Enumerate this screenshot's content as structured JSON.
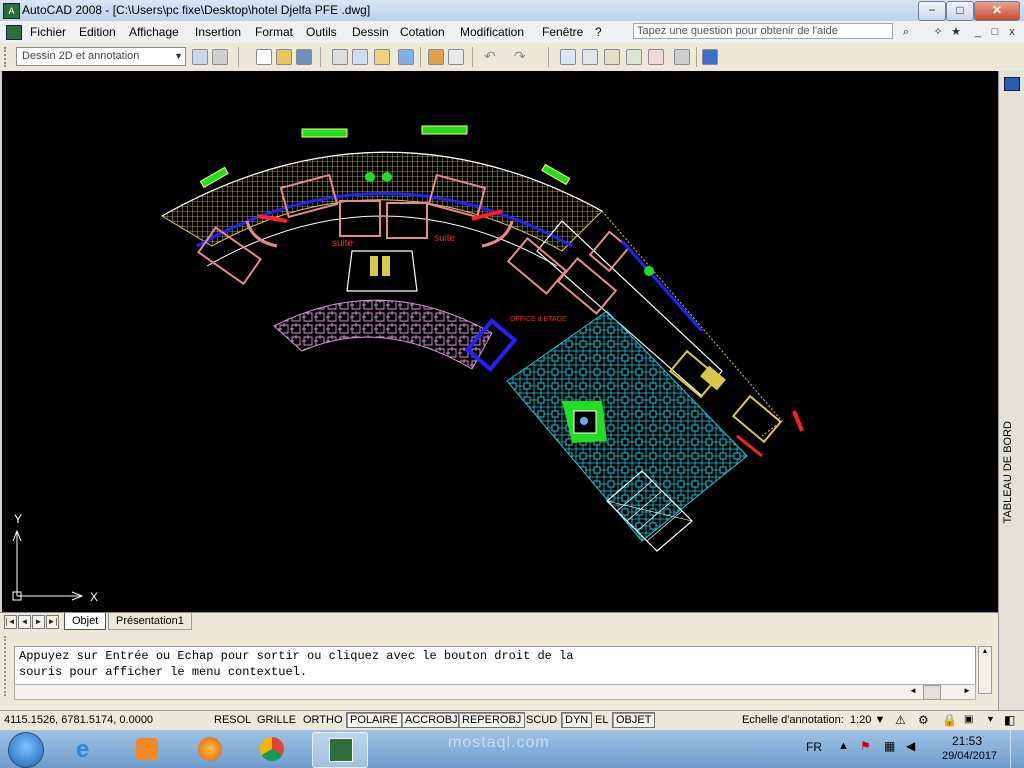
{
  "window": {
    "title": "AutoCAD 2008 - [C:\\Users\\pc fixe\\Desktop\\hotel Djelfa PFE .dwg]",
    "app_icon_label": "A",
    "minimize": "−",
    "maximize": "□",
    "close": "✕"
  },
  "menubar": {
    "items": [
      "Fichier",
      "Edition",
      "Affichage",
      "Insertion",
      "Format",
      "Outils",
      "Dessin",
      "Cotation",
      "Modification",
      "Fenêtre",
      "?"
    ],
    "help_placeholder": "Tapez une question pour obtenir de l'aide",
    "doc_min": "_",
    "doc_max": "□",
    "doc_close": "x"
  },
  "toolbar": {
    "workspace": "Dessin 2D et annotation"
  },
  "drawing": {
    "labels": {
      "suite_left": "suite",
      "suite_right": "suite",
      "office": "OFFICE d ETAGE"
    },
    "ucs": {
      "y": "Y",
      "x": "X"
    },
    "colors": {
      "yellow_hatch": "#d8c84a",
      "cyan_hatch": "#19c8d8",
      "magenta_hatch": "#d896d8",
      "wall_blue": "#2222ff",
      "furniture": "#e88a8a",
      "red": "#ff2020",
      "green": "#22dd22"
    }
  },
  "tableau": {
    "label": "TABLEAU DE BORD"
  },
  "tabs": {
    "nav": [
      "|◄",
      "◄",
      "►",
      "►|"
    ],
    "items": [
      "Objet",
      "Présentation1"
    ]
  },
  "command": {
    "line1": "Appuyez sur Entrée ou Echap pour sortir ou cliquez avec le bouton droit de la",
    "line2": "souris pour afficher le menu contextuel."
  },
  "status": {
    "coords": "4115.1526, 6781.5174, 0.0000",
    "buttons": [
      {
        "label": "RESOL",
        "on": false
      },
      {
        "label": "GRILLE",
        "on": false
      },
      {
        "label": "ORTHO",
        "on": false
      },
      {
        "label": "POLAIRE",
        "on": true
      },
      {
        "label": "ACCROBJ",
        "on": true
      },
      {
        "label": "REPEROBJ",
        "on": true
      },
      {
        "label": "SCUD",
        "on": false
      },
      {
        "label": "DYN",
        "on": true
      },
      {
        "label": "EL",
        "on": false
      },
      {
        "label": "OBJET",
        "on": true
      }
    ],
    "annot_label": "Echelle d'annotation:",
    "annot_scale": "1:20 ▼"
  },
  "taskbar": {
    "lang": "FR",
    "time": "21:53",
    "date": "29/04/2017",
    "watermark": "mostaql.com"
  }
}
